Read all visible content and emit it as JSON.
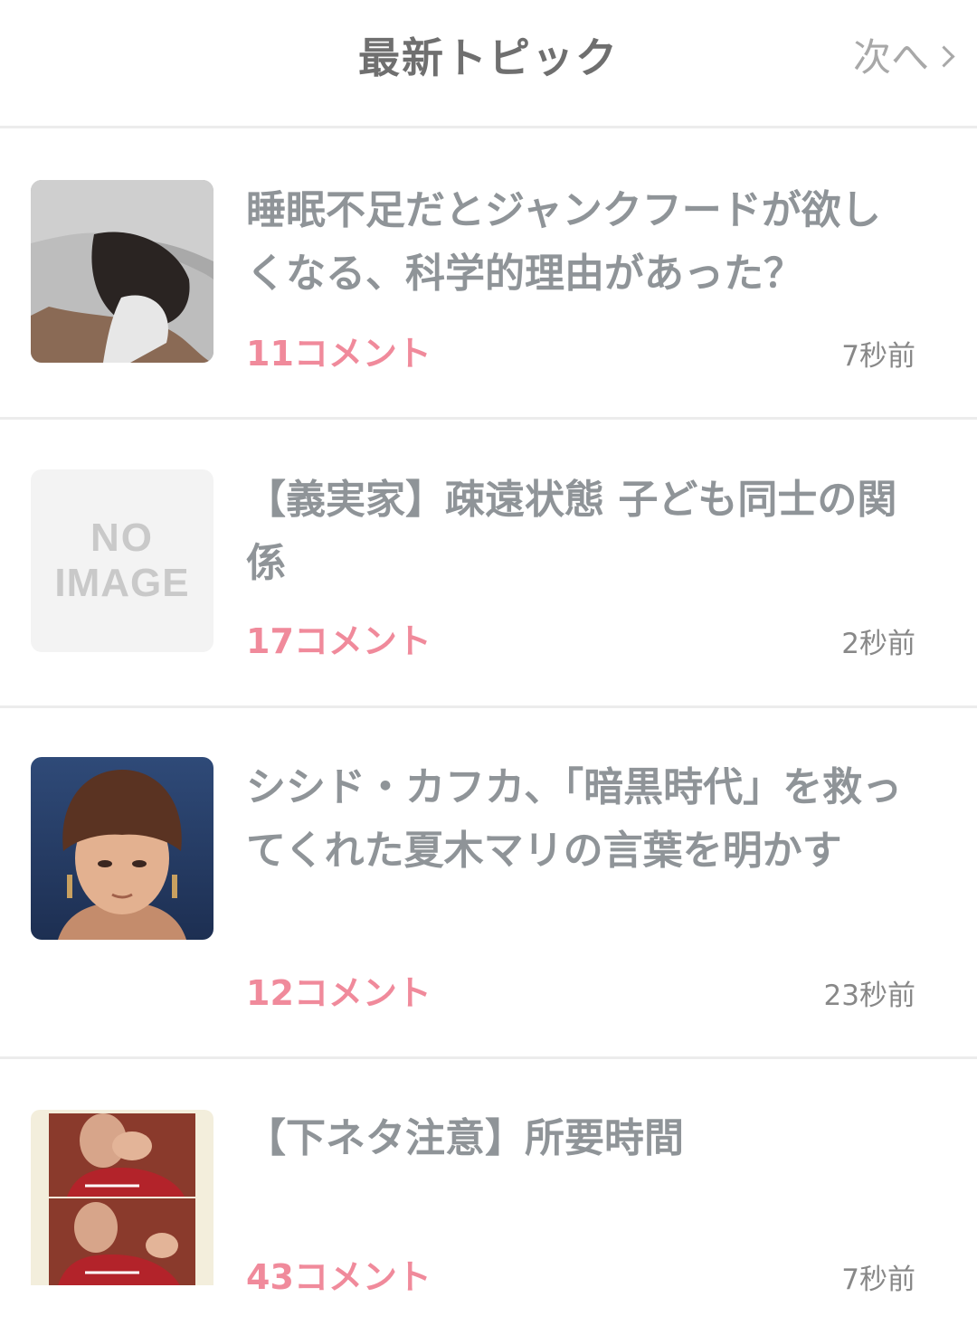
{
  "header": {
    "title": "最新トピック",
    "next_label": "次へ"
  },
  "topics": [
    {
      "title": "睡眠不足だとジャンクフードが欲しくなる、科学的理由があった？",
      "comments": "11コメント",
      "time": "7秒前",
      "thumb": "photo"
    },
    {
      "title": "【義実家】疎遠状態 子ども同士の関係",
      "comments": "17コメント",
      "time": "2秒前",
      "thumb": "noimage",
      "noimage_line1": "NO",
      "noimage_line2": "IMAGE"
    },
    {
      "title": "シシド・カフカ、「暗黒時代」を救ってくれた夏木マリの言葉を明かす",
      "comments": "12コメント",
      "time": "23秒前",
      "thumb": "photo"
    },
    {
      "title": "【下ネタ注意】所要時間",
      "comments": "43コメント",
      "time": "7秒前",
      "thumb": "photo"
    }
  ]
}
